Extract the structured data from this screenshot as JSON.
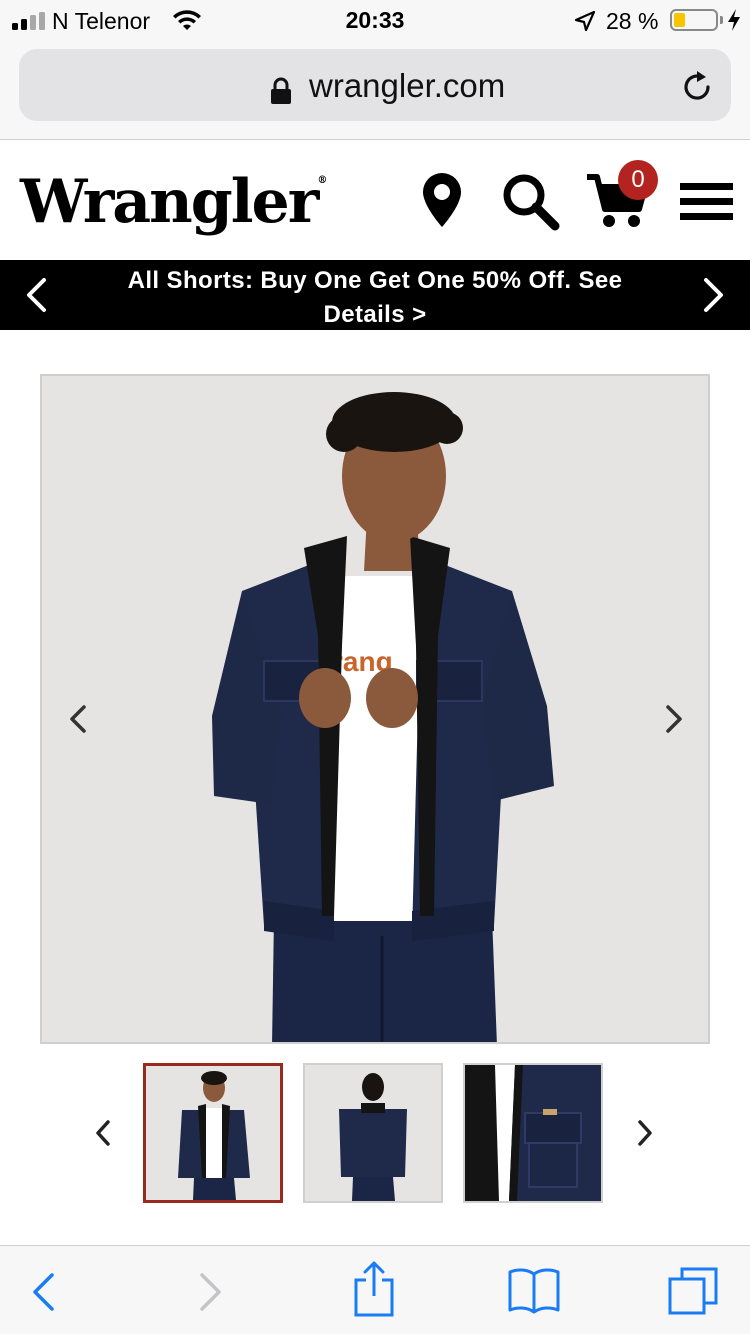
{
  "status_bar": {
    "carrier": "N Telenor",
    "time": "20:33",
    "battery_percent": "28 %",
    "battery_level": 0.28,
    "icons": [
      "signal-icon",
      "wifi-icon",
      "location-arrow-icon",
      "battery-icon",
      "charging-bolt-icon"
    ]
  },
  "browser": {
    "url": "wrangler.com",
    "icons": [
      "lock-icon",
      "reload-icon"
    ]
  },
  "header": {
    "logo_text": "Wrangler",
    "logo_mark": "®",
    "cart_count": "0",
    "icons": [
      "location-pin-icon",
      "search-icon",
      "cart-icon",
      "hamburger-menu-icon"
    ]
  },
  "promo": {
    "text": "All Shorts: Buy One Get One 50% Off. See Details >",
    "icons": [
      "chevron-left-icon",
      "chevron-right-icon"
    ]
  },
  "gallery": {
    "main_alt": "Man wearing dark denim sherpa-collar jacket over white tee",
    "thumbnails": [
      {
        "label": "front view",
        "selected": true
      },
      {
        "label": "back view",
        "selected": false
      },
      {
        "label": "collar detail",
        "selected": false
      }
    ]
  },
  "toolbar": {
    "icons": [
      "back-icon",
      "forward-icon",
      "share-icon",
      "bookmarks-icon",
      "tabs-icon"
    ],
    "tint": "#1a7cf5",
    "disabled_tint": "#c4c4c8"
  },
  "colors": {
    "brand_red": "#b3231f",
    "selected_border": "#9a2a1f",
    "denim": "#1f2a4a"
  }
}
